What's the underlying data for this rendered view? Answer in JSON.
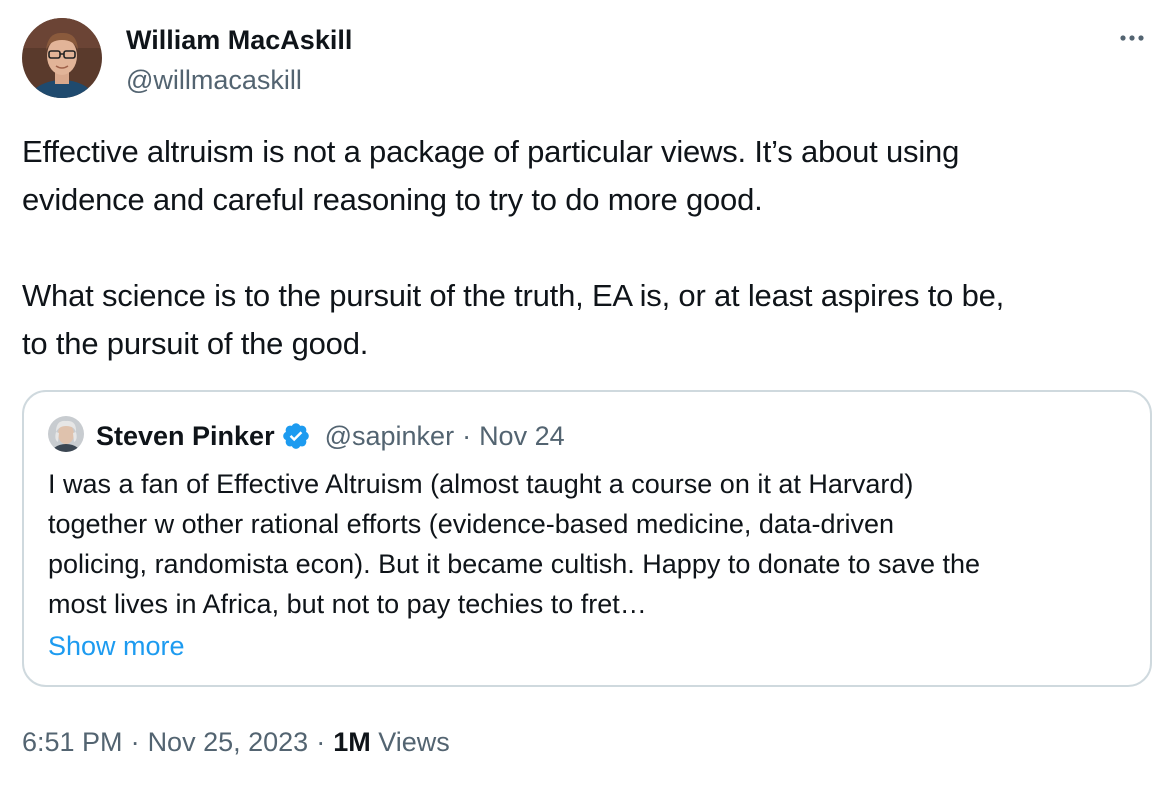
{
  "author": {
    "name": "William MacAskill",
    "handle": "@willmacaskill"
  },
  "tweet": {
    "lines": [
      "Effective altruism is not a package of particular views. It’s about using",
      "evidence and careful reasoning to try to do more good.",
      "What science is to the pursuit of the truth, EA is, or at least aspires to be,",
      "to the pursuit of the good."
    ]
  },
  "quote": {
    "name": "Steven Pinker",
    "handle": "@sapinker",
    "separator": "·",
    "date": "Nov 24",
    "lines": [
      "I was a fan of Effective Altruism (almost taught a course on it at Harvard)",
      "together w other rational efforts (evidence-based medicine, data-driven",
      "policing, randomista econ). But it became cultish. Happy to donate to save the",
      "most lives in Africa, but not to pay techies to fret…"
    ],
    "show_more": "Show more"
  },
  "meta": {
    "time": "6:51 PM",
    "separator": "·",
    "date": "Nov 25, 2023",
    "views_count": "1M",
    "views_label": "Views"
  },
  "icons": {
    "more": "more-horizontal-icon",
    "verified": "verified-badge-icon"
  },
  "colors": {
    "text": "#0f1419",
    "secondary": "#536471",
    "link": "#1d9bf0",
    "border": "#cfd9de",
    "verified": "#1d9bf0"
  }
}
